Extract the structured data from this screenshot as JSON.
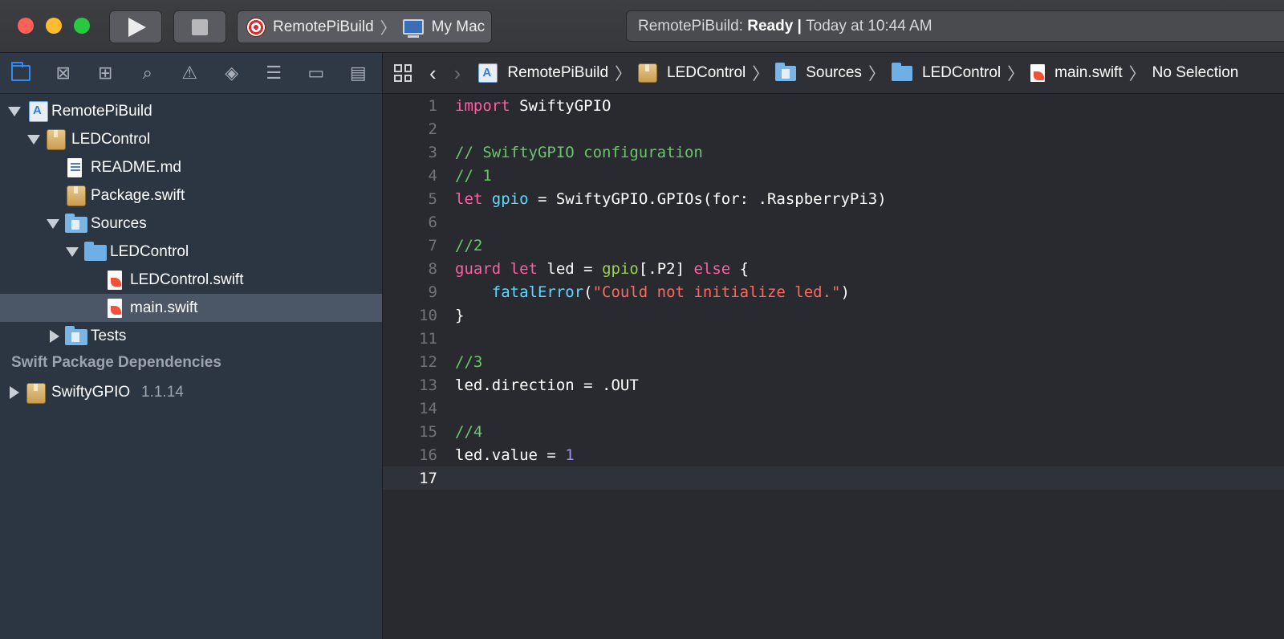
{
  "toolbar": {
    "scheme_name": "RemotePiBuild",
    "destination": "My Mac",
    "status_prefix": "RemotePiBuild:",
    "status_state": "Ready",
    "status_separator": "|",
    "status_time": "Today at 10:44 AM"
  },
  "navigator": {
    "tabs": [
      "project-navigator",
      "source-control-navigator",
      "symbol-navigator",
      "find-navigator",
      "issue-navigator",
      "test-navigator",
      "debug-navigator",
      "breakpoint-navigator",
      "report-navigator"
    ],
    "tree": [
      {
        "label": "RemotePiBuild",
        "icon": "project-icon",
        "disclosure": "open",
        "selected": false
      },
      {
        "label": "LEDControl",
        "icon": "package-icon",
        "disclosure": "open",
        "selected": false
      },
      {
        "label": "README.md",
        "icon": "document-icon",
        "disclosure": "none",
        "selected": false
      },
      {
        "label": "Package.swift",
        "icon": "package-icon",
        "disclosure": "none",
        "selected": false
      },
      {
        "label": "Sources",
        "icon": "group-folder-icon",
        "disclosure": "open",
        "selected": false
      },
      {
        "label": "LEDControl",
        "icon": "folder-icon",
        "disclosure": "open",
        "selected": false
      },
      {
        "label": "LEDControl.swift",
        "icon": "swift-file-icon",
        "disclosure": "none",
        "selected": false
      },
      {
        "label": "main.swift",
        "icon": "swift-file-icon",
        "disclosure": "none",
        "selected": true
      },
      {
        "label": "Tests",
        "icon": "test-folder-icon",
        "disclosure": "closed",
        "selected": false
      }
    ],
    "dependencies_header": "Swift Package Dependencies",
    "dependency": {
      "label": "SwiftyGPIO",
      "version": "1.1.14"
    }
  },
  "jumpbar": {
    "crumbs": [
      "RemotePiBuild",
      "LEDControl",
      "Sources",
      "LEDControl",
      "main.swift"
    ],
    "selection": "No Selection"
  },
  "editor": {
    "current_line": 17,
    "lines": [
      {
        "n": "1",
        "text": "import SwiftyGPIO"
      },
      {
        "n": "2",
        "text": ""
      },
      {
        "n": "3",
        "text": "// SwiftyGPIO configuration"
      },
      {
        "n": "4",
        "text": "// 1"
      },
      {
        "n": "5",
        "text": "let gpio = SwiftyGPIO.GPIOs(for: .RaspberryPi3)"
      },
      {
        "n": "6",
        "text": ""
      },
      {
        "n": "7",
        "text": "//2"
      },
      {
        "n": "8",
        "text": "guard let led = gpio[.P2] else {"
      },
      {
        "n": "9",
        "text": "    fatalError(\"Could not initialize led.\")"
      },
      {
        "n": "10",
        "text": "}"
      },
      {
        "n": "11",
        "text": ""
      },
      {
        "n": "12",
        "text": "//3"
      },
      {
        "n": "13",
        "text": "led.direction = .OUT"
      },
      {
        "n": "14",
        "text": ""
      },
      {
        "n": "15",
        "text": "//4"
      },
      {
        "n": "16",
        "text": "led.value = 1"
      },
      {
        "n": "17",
        "text": ""
      }
    ]
  },
  "colors": {
    "keyword": "#fc5fa3",
    "comment": "#6bc66b",
    "string": "#fc6a5d",
    "number": "#9e8ff2",
    "selection": "#4b5667",
    "accent": "#2f8cf7"
  }
}
